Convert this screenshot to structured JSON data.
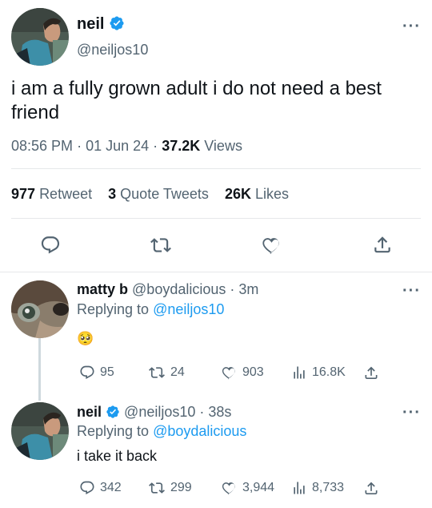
{
  "main_tweet": {
    "author_name": "neil",
    "handle": "@neiljos10",
    "text": "i am a fully grown adult i do not need a best friend",
    "time": "08:56 PM",
    "date": "01 Jun 24",
    "views_count": "37.2K",
    "views_label": "Views",
    "sep1": "·",
    "sep2": "·",
    "retweets_count": "977",
    "retweets_label": "Retweet",
    "quotes_count": "3",
    "quotes_label": "Quote Tweets",
    "likes_count": "26K",
    "likes_label": "Likes"
  },
  "reply1": {
    "author_name": "matty b",
    "handle": "@boydalicious",
    "sep": "·",
    "age": "3m",
    "replying_prefix": "Replying to",
    "replying_to": "@neiljos10",
    "text": "🥺",
    "replies": "95",
    "retweets": "24",
    "likes": "903",
    "views": "16.8K"
  },
  "reply2": {
    "author_name": "neil",
    "handle": "@neiljos10",
    "sep": "·",
    "age": "38s",
    "replying_prefix": "Replying to",
    "replying_to": "@boydalicious",
    "text": "i take it back",
    "replies": "342",
    "retweets": "299",
    "likes": "3,944",
    "views": "8,733"
  },
  "icons": {
    "more": "more-icon",
    "verified": "verified-badge-icon",
    "reply": "reply-icon",
    "retweet": "retweet-icon",
    "like": "heart-icon",
    "share": "share-icon",
    "views": "views-chart-icon"
  },
  "colors": {
    "accent": "#1d9bf0",
    "muted": "#536471",
    "text": "#0f1419"
  }
}
